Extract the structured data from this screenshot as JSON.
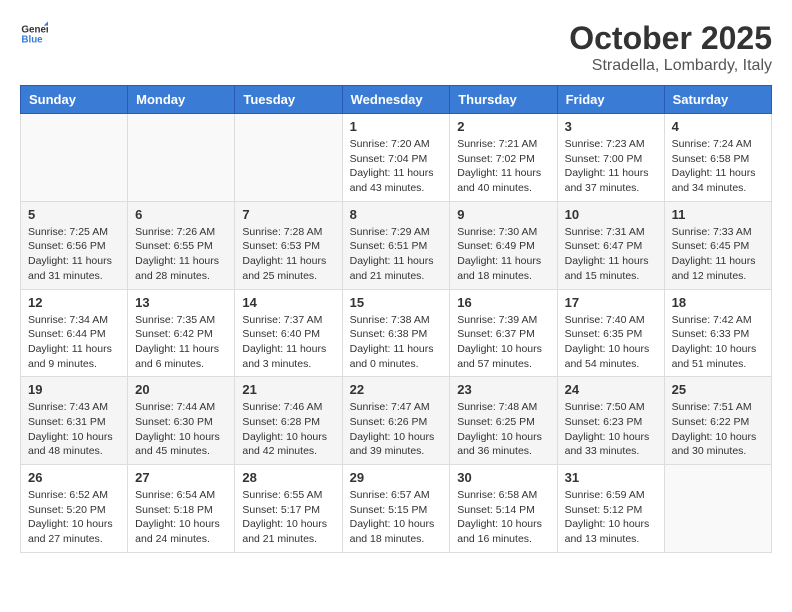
{
  "header": {
    "logo_general": "General",
    "logo_blue": "Blue",
    "month_title": "October 2025",
    "location": "Stradella, Lombardy, Italy"
  },
  "days_of_week": [
    "Sunday",
    "Monday",
    "Tuesday",
    "Wednesday",
    "Thursday",
    "Friday",
    "Saturday"
  ],
  "weeks": [
    [
      {
        "day": "",
        "info": ""
      },
      {
        "day": "",
        "info": ""
      },
      {
        "day": "",
        "info": ""
      },
      {
        "day": "1",
        "info": "Sunrise: 7:20 AM\nSunset: 7:04 PM\nDaylight: 11 hours and 43 minutes."
      },
      {
        "day": "2",
        "info": "Sunrise: 7:21 AM\nSunset: 7:02 PM\nDaylight: 11 hours and 40 minutes."
      },
      {
        "day": "3",
        "info": "Sunrise: 7:23 AM\nSunset: 7:00 PM\nDaylight: 11 hours and 37 minutes."
      },
      {
        "day": "4",
        "info": "Sunrise: 7:24 AM\nSunset: 6:58 PM\nDaylight: 11 hours and 34 minutes."
      }
    ],
    [
      {
        "day": "5",
        "info": "Sunrise: 7:25 AM\nSunset: 6:56 PM\nDaylight: 11 hours and 31 minutes."
      },
      {
        "day": "6",
        "info": "Sunrise: 7:26 AM\nSunset: 6:55 PM\nDaylight: 11 hours and 28 minutes."
      },
      {
        "day": "7",
        "info": "Sunrise: 7:28 AM\nSunset: 6:53 PM\nDaylight: 11 hours and 25 minutes."
      },
      {
        "day": "8",
        "info": "Sunrise: 7:29 AM\nSunset: 6:51 PM\nDaylight: 11 hours and 21 minutes."
      },
      {
        "day": "9",
        "info": "Sunrise: 7:30 AM\nSunset: 6:49 PM\nDaylight: 11 hours and 18 minutes."
      },
      {
        "day": "10",
        "info": "Sunrise: 7:31 AM\nSunset: 6:47 PM\nDaylight: 11 hours and 15 minutes."
      },
      {
        "day": "11",
        "info": "Sunrise: 7:33 AM\nSunset: 6:45 PM\nDaylight: 11 hours and 12 minutes."
      }
    ],
    [
      {
        "day": "12",
        "info": "Sunrise: 7:34 AM\nSunset: 6:44 PM\nDaylight: 11 hours and 9 minutes."
      },
      {
        "day": "13",
        "info": "Sunrise: 7:35 AM\nSunset: 6:42 PM\nDaylight: 11 hours and 6 minutes."
      },
      {
        "day": "14",
        "info": "Sunrise: 7:37 AM\nSunset: 6:40 PM\nDaylight: 11 hours and 3 minutes."
      },
      {
        "day": "15",
        "info": "Sunrise: 7:38 AM\nSunset: 6:38 PM\nDaylight: 11 hours and 0 minutes."
      },
      {
        "day": "16",
        "info": "Sunrise: 7:39 AM\nSunset: 6:37 PM\nDaylight: 10 hours and 57 minutes."
      },
      {
        "day": "17",
        "info": "Sunrise: 7:40 AM\nSunset: 6:35 PM\nDaylight: 10 hours and 54 minutes."
      },
      {
        "day": "18",
        "info": "Sunrise: 7:42 AM\nSunset: 6:33 PM\nDaylight: 10 hours and 51 minutes."
      }
    ],
    [
      {
        "day": "19",
        "info": "Sunrise: 7:43 AM\nSunset: 6:31 PM\nDaylight: 10 hours and 48 minutes."
      },
      {
        "day": "20",
        "info": "Sunrise: 7:44 AM\nSunset: 6:30 PM\nDaylight: 10 hours and 45 minutes."
      },
      {
        "day": "21",
        "info": "Sunrise: 7:46 AM\nSunset: 6:28 PM\nDaylight: 10 hours and 42 minutes."
      },
      {
        "day": "22",
        "info": "Sunrise: 7:47 AM\nSunset: 6:26 PM\nDaylight: 10 hours and 39 minutes."
      },
      {
        "day": "23",
        "info": "Sunrise: 7:48 AM\nSunset: 6:25 PM\nDaylight: 10 hours and 36 minutes."
      },
      {
        "day": "24",
        "info": "Sunrise: 7:50 AM\nSunset: 6:23 PM\nDaylight: 10 hours and 33 minutes."
      },
      {
        "day": "25",
        "info": "Sunrise: 7:51 AM\nSunset: 6:22 PM\nDaylight: 10 hours and 30 minutes."
      }
    ],
    [
      {
        "day": "26",
        "info": "Sunrise: 6:52 AM\nSunset: 5:20 PM\nDaylight: 10 hours and 27 minutes."
      },
      {
        "day": "27",
        "info": "Sunrise: 6:54 AM\nSunset: 5:18 PM\nDaylight: 10 hours and 24 minutes."
      },
      {
        "day": "28",
        "info": "Sunrise: 6:55 AM\nSunset: 5:17 PM\nDaylight: 10 hours and 21 minutes."
      },
      {
        "day": "29",
        "info": "Sunrise: 6:57 AM\nSunset: 5:15 PM\nDaylight: 10 hours and 18 minutes."
      },
      {
        "day": "30",
        "info": "Sunrise: 6:58 AM\nSunset: 5:14 PM\nDaylight: 10 hours and 16 minutes."
      },
      {
        "day": "31",
        "info": "Sunrise: 6:59 AM\nSunset: 5:12 PM\nDaylight: 10 hours and 13 minutes."
      },
      {
        "day": "",
        "info": ""
      }
    ]
  ]
}
